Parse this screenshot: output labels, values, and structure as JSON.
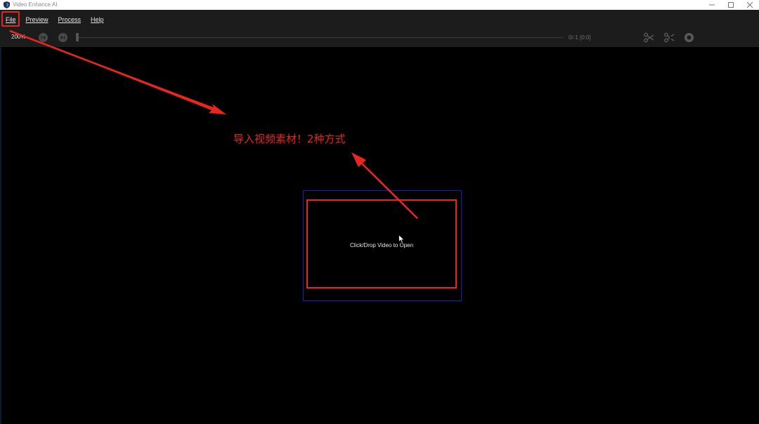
{
  "window": {
    "title": "Video Enhance AI",
    "controls": [
      "minimize",
      "maximize",
      "close"
    ]
  },
  "menu": {
    "items": [
      {
        "label": "File"
      },
      {
        "label": "Preview"
      },
      {
        "label": "Process"
      },
      {
        "label": "Help"
      }
    ]
  },
  "toolbar": {
    "zoom": "200%",
    "frame_counter": "0/-1  [0:0]",
    "icons": [
      "prev-frame-icon",
      "next-frame-icon",
      "cut-icon",
      "uncut-icon",
      "record-icon"
    ]
  },
  "main": {
    "drop_zone_text": "Click/Drop Video to Open"
  },
  "annotation": {
    "text": "导入视频素材！2种方式",
    "color": "#e8261f"
  }
}
